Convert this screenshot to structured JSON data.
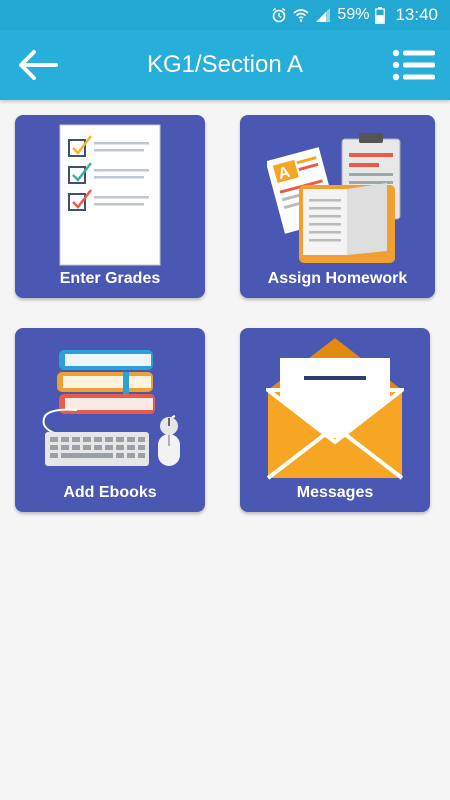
{
  "status_bar": {
    "battery_percent": "59%",
    "time": "13:40",
    "icons": [
      "alarm-icon",
      "wifi-icon",
      "signal-icon",
      "battery-icon"
    ]
  },
  "header": {
    "title": "KG1/Section A",
    "back_icon": "arrow-left-icon",
    "menu_icon": "list-menu-icon",
    "color": "#28aedb"
  },
  "tiles": [
    {
      "label": "Enter Grades",
      "icon": "checklist-icon"
    },
    {
      "label": "Assign Homework",
      "icon": "homework-icon"
    },
    {
      "label": "Add Ebooks",
      "icon": "ebooks-icon"
    },
    {
      "label": "Messages",
      "icon": "envelope-icon"
    }
  ],
  "colors": {
    "tile_background": "#4a58b3",
    "page_background": "#f5f5f5"
  }
}
